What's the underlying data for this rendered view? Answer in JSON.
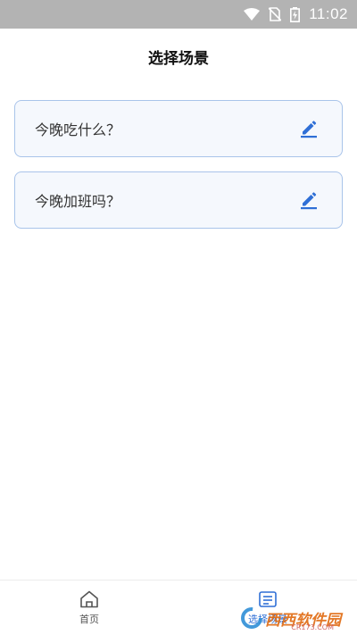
{
  "status_bar": {
    "time": "11:02",
    "icons": [
      "wifi-icon",
      "no-sim-icon",
      "battery-charging-icon"
    ]
  },
  "header": {
    "title": "选择场景"
  },
  "scenes": [
    {
      "label": "今晚吃什么？",
      "action_icon": "edit-icon"
    },
    {
      "label": "今晚加班吗？",
      "action_icon": "edit-icon"
    }
  ],
  "tab_bar": {
    "items": [
      {
        "label": "首页",
        "icon": "home-icon",
        "active": false
      },
      {
        "label": "选择场景",
        "icon": "scene-list-icon",
        "active": true
      }
    ]
  },
  "colors": {
    "accent": "#2f6fd6",
    "card_background": "#f5f8fd",
    "card_border": "#a9c4ea",
    "status_bar": "#b3b3b3"
  },
  "watermark": {
    "text": "西西软件园",
    "url_text": "CR173.COM"
  }
}
